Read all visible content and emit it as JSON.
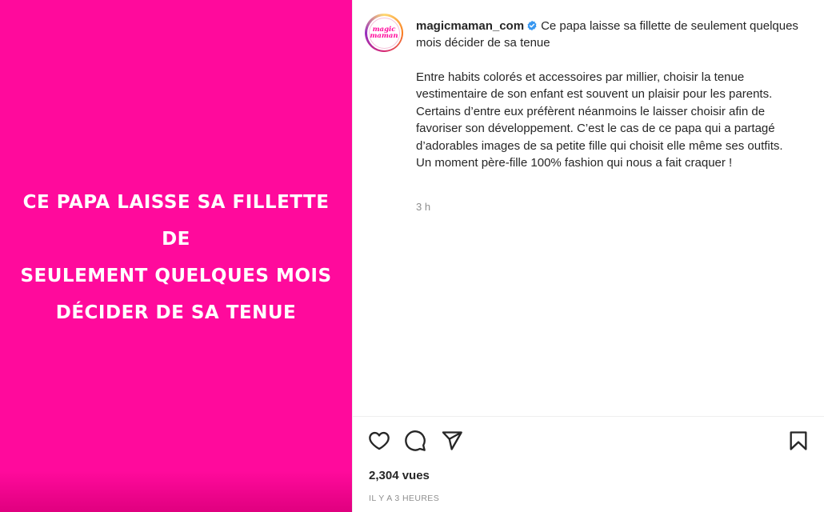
{
  "media": {
    "overlay_lines": [
      "CE PAPA LAISSE SA FILLETTE DE",
      "SEULEMENT QUELQUES MOIS",
      "DÉCIDER DE SA TENUE"
    ],
    "background_color": "#ff0a9c"
  },
  "post": {
    "avatar_text_top": "magic",
    "avatar_text_bottom": "maman",
    "username": "magicmaman_com",
    "verified_icon": "verified-badge-icon",
    "title": "Ce papa laisse sa fillette de seulement quelques mois décider de sa tenue",
    "body": "Entre habits colorés et accessoires par millier, choisir la tenue vestimentaire de son enfant est souvent un plaisir pour les parents. Certains d’entre eux préfèrent néanmoins le laisser choisir afin de favoriser son développement. C’est le cas de ce papa qui a partagé d’adorables images de sa petite fille qui choisit elle même ses outfits. Un moment père-fille 100% fashion qui nous a fait craquer !",
    "time_short": "3 h",
    "views": "2,304 vues",
    "posted_ago": "IL Y A 3 HEURES"
  },
  "actions": {
    "like_icon": "heart-icon",
    "comment_icon": "comment-icon",
    "share_icon": "send-icon",
    "save_icon": "bookmark-icon"
  },
  "colors": {
    "accent": "#ff0a9c",
    "verified": "#3897f0",
    "muted": "#8e8e8e"
  }
}
